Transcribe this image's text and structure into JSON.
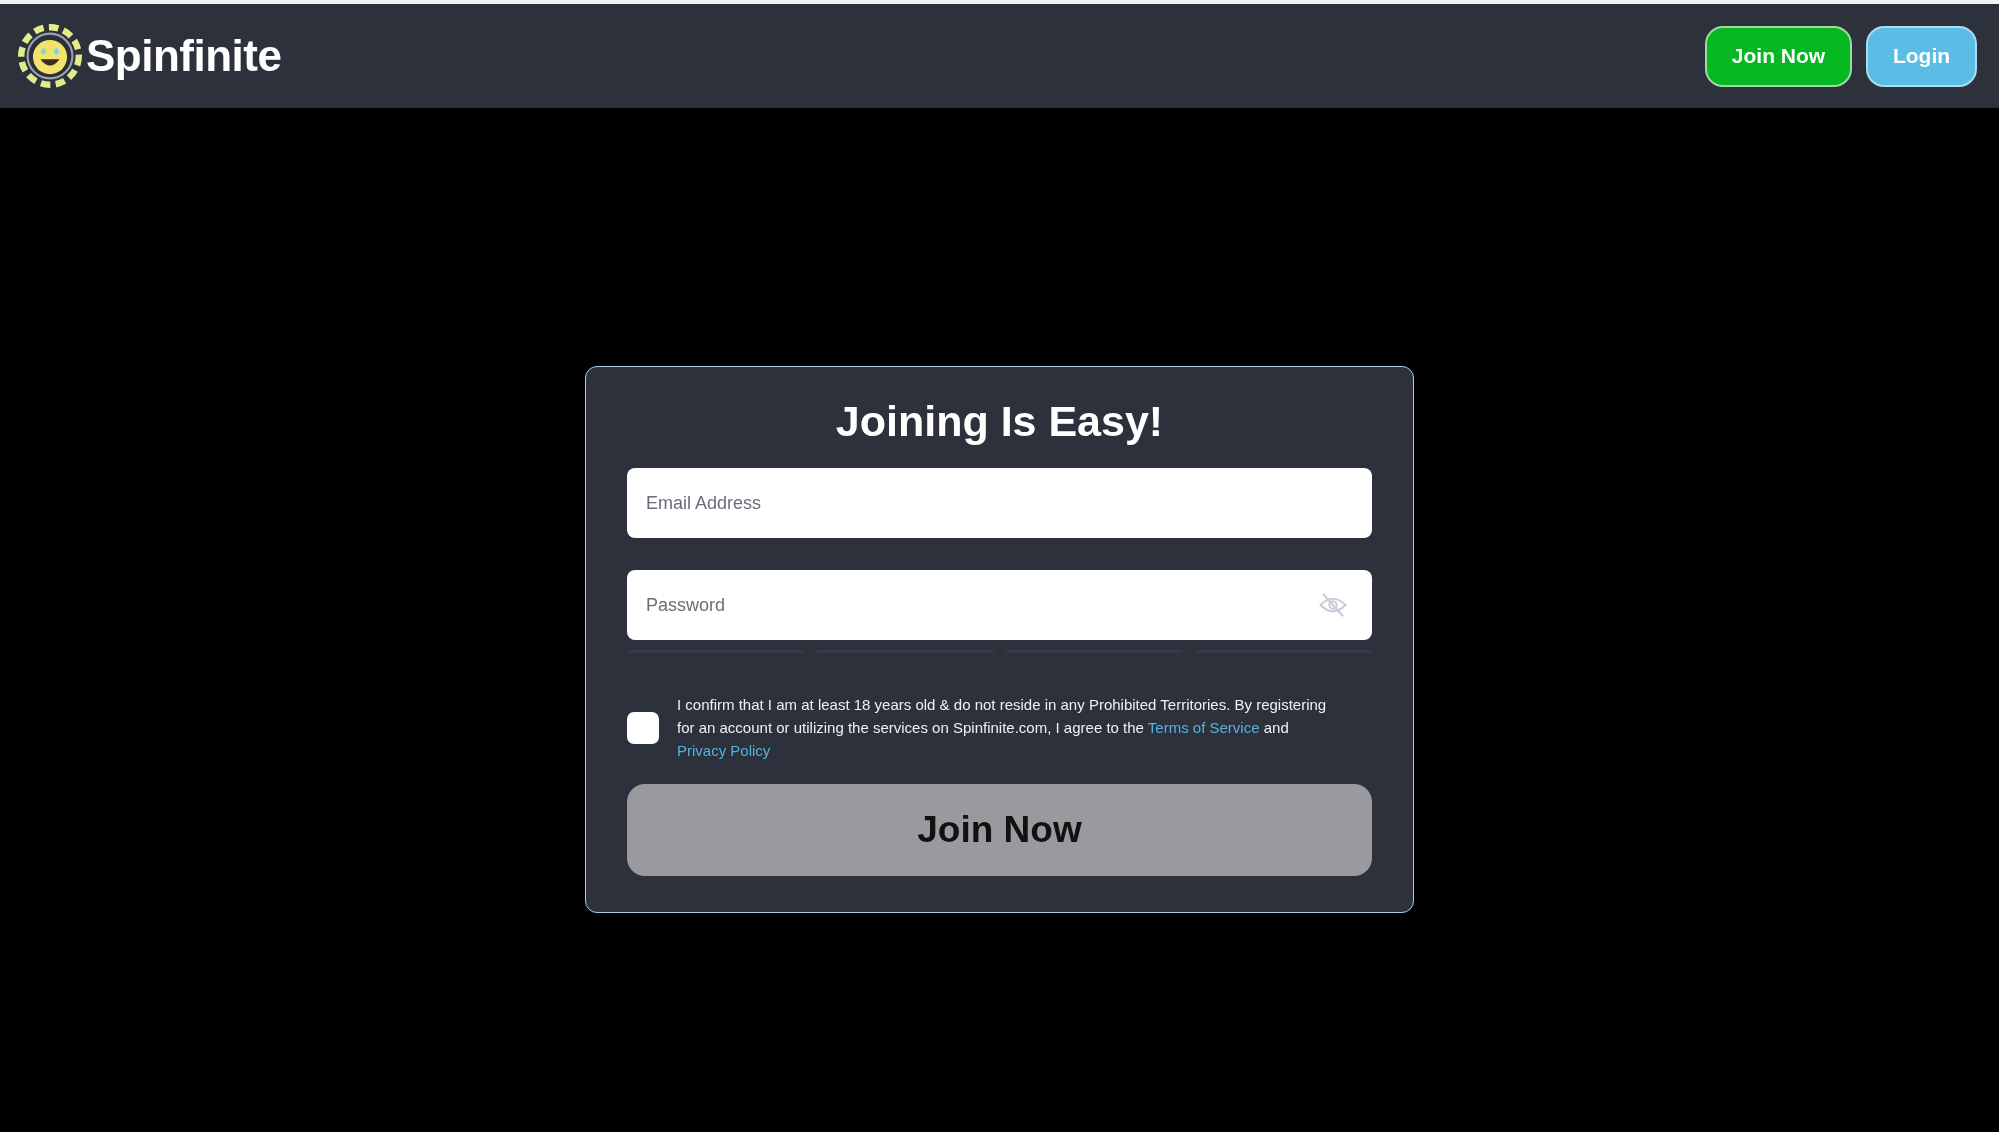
{
  "header": {
    "brand": "Spinfinite",
    "buttons": [
      {
        "label": "Join Now",
        "kind": "primary"
      },
      {
        "label": "Login",
        "kind": "secondary"
      }
    ]
  },
  "form": {
    "title": "Joining Is Easy!",
    "fields": [
      {
        "placeholder": "Email Address",
        "kind": "email"
      },
      {
        "placeholder": "Password",
        "kind": "password"
      }
    ],
    "consent": {
      "checked": false,
      "parts": [
        {
          "kind": "plain",
          "text": "I confirm that I am at least 18 years old & do not reside in any Prohibited Territories. By registering for an account or utilizing the services on Spinfinite.com, I agree to the "
        },
        {
          "kind": "link",
          "text": "Terms of Service"
        },
        {
          "kind": "plain",
          "text": " and "
        },
        {
          "kind": "link",
          "text": "Privacy Policy"
        }
      ]
    },
    "submit": {
      "label": "Join Now",
      "disabled": true
    }
  }
}
